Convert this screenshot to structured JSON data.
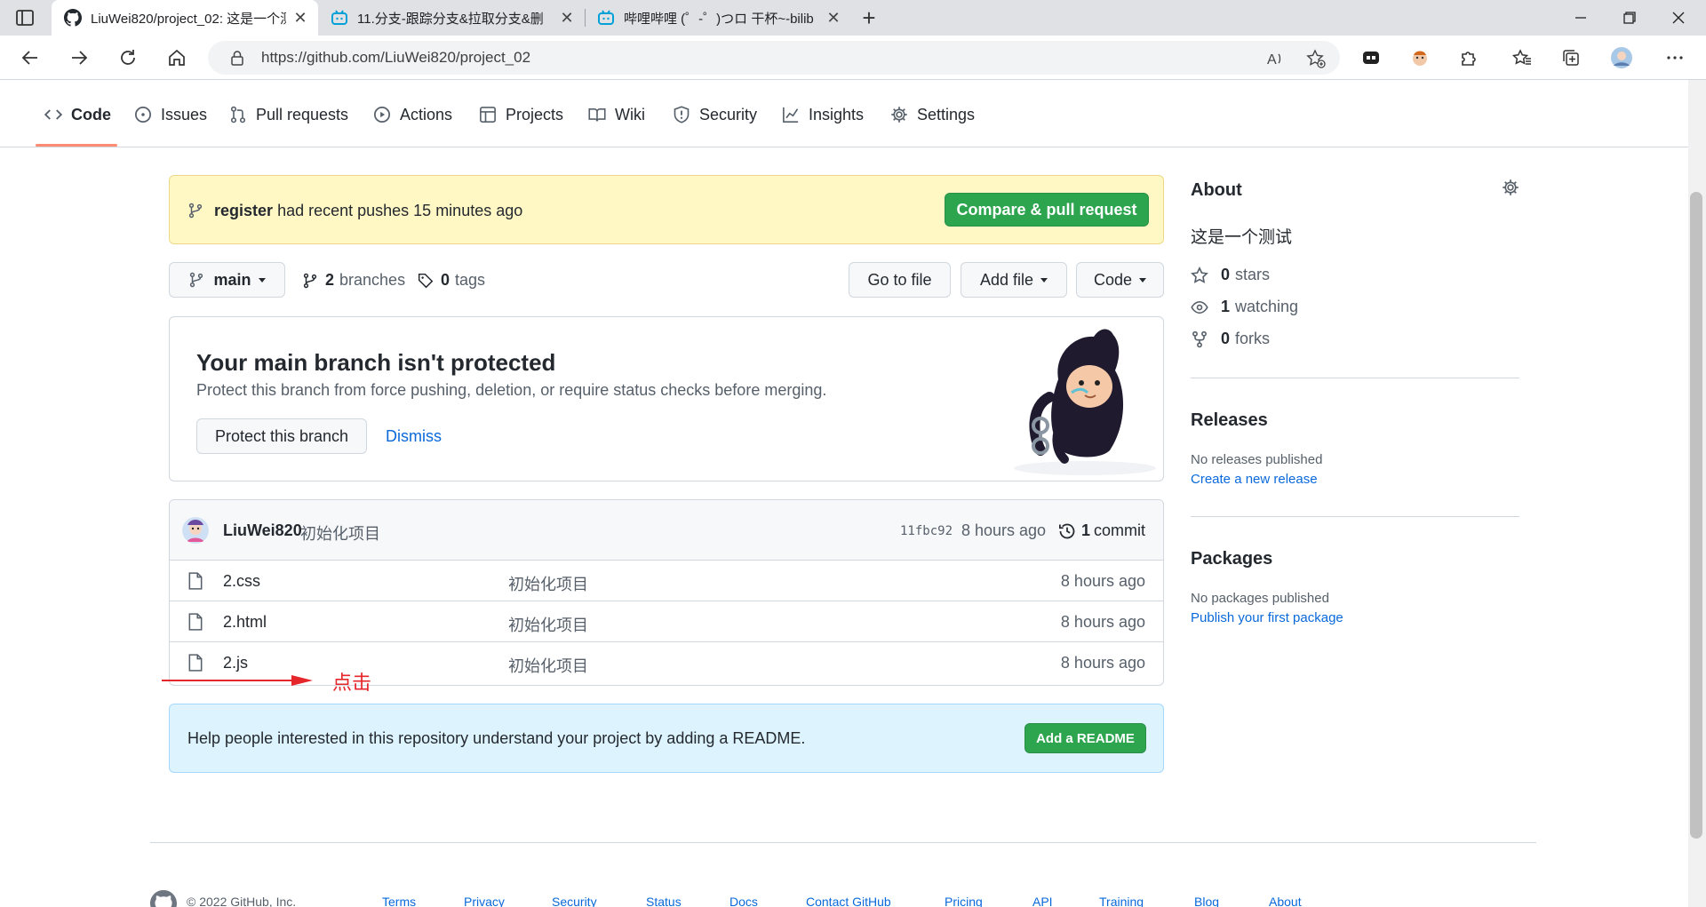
{
  "browser": {
    "tabs": [
      {
        "label": "LiuWei820/project_02: 这是一个测",
        "icon": "github-icon",
        "active": true
      },
      {
        "label": "11.分支-跟踪分支&拉取分支&删",
        "icon": "bilibili-icon",
        "active": false
      },
      {
        "label": "哔哩哔哩 (゜-゜)つロ 干杯~-bilib",
        "icon": "bilibili-icon",
        "active": false
      }
    ],
    "url": "https://github.com/LiuWei820/project_02"
  },
  "repo_nav": {
    "items": [
      {
        "label": "Code",
        "icon": "code-icon"
      },
      {
        "label": "Issues",
        "icon": "issue-icon"
      },
      {
        "label": "Pull requests",
        "icon": "pull-request-icon"
      },
      {
        "label": "Actions",
        "icon": "play-icon"
      },
      {
        "label": "Projects",
        "icon": "table-icon"
      },
      {
        "label": "Wiki",
        "icon": "book-icon"
      },
      {
        "label": "Security",
        "icon": "shield-icon"
      },
      {
        "label": "Insights",
        "icon": "graph-icon"
      },
      {
        "label": "Settings",
        "icon": "gear-icon"
      }
    ]
  },
  "flash": {
    "branch": "register",
    "message": "had recent pushes 15 minutes ago",
    "button": "Compare & pull request"
  },
  "toolbar": {
    "branch": "main",
    "branches_count": "2",
    "branches_label": "branches",
    "tags_count": "0",
    "tags_label": "tags",
    "goto_file": "Go to file",
    "add_file": "Add file",
    "code": "Code"
  },
  "protect": {
    "title": "Your main branch isn't protected",
    "description": "Protect this branch from force pushing, deletion, or require status checks before merging.",
    "protect_button": "Protect this branch",
    "dismiss": "Dismiss"
  },
  "commit": {
    "author": "LiuWei820",
    "message": "初始化项目",
    "sha": "11fbc92",
    "time": "8 hours ago",
    "count": "1",
    "count_label": "commit"
  },
  "files": [
    {
      "name": "2.css",
      "message": "初始化项目",
      "time": "8 hours ago"
    },
    {
      "name": "2.html",
      "message": "初始化项目",
      "time": "8 hours ago"
    },
    {
      "name": "2.js",
      "message": "初始化项目",
      "time": "8 hours ago"
    }
  ],
  "readme": {
    "message": "Help people interested in this repository understand your project by adding a README.",
    "button": "Add a README"
  },
  "annotation": {
    "text": "点击",
    "color": "#e5262b"
  },
  "about": {
    "title": "About",
    "description": "这是一个测试",
    "stars_count": "0",
    "stars_label": "stars",
    "watching_count": "1",
    "watching_label": "watching",
    "forks_count": "0",
    "forks_label": "forks"
  },
  "releases": {
    "title": "Releases",
    "none": "No releases published",
    "link": "Create a new release"
  },
  "packages": {
    "title": "Packages",
    "none": "No packages published",
    "link": "Publish your first package"
  },
  "footer": {
    "copyright": "© 2022 GitHub, Inc.",
    "links": [
      "Terms",
      "Privacy",
      "Security",
      "Status",
      "Docs",
      "Contact GitHub",
      "Pricing",
      "API",
      "Training",
      "Blog",
      "About"
    ]
  },
  "colors": {
    "accent_green": "#2da44e",
    "link_blue": "#0969da",
    "tab_underline": "#fd8c73"
  }
}
